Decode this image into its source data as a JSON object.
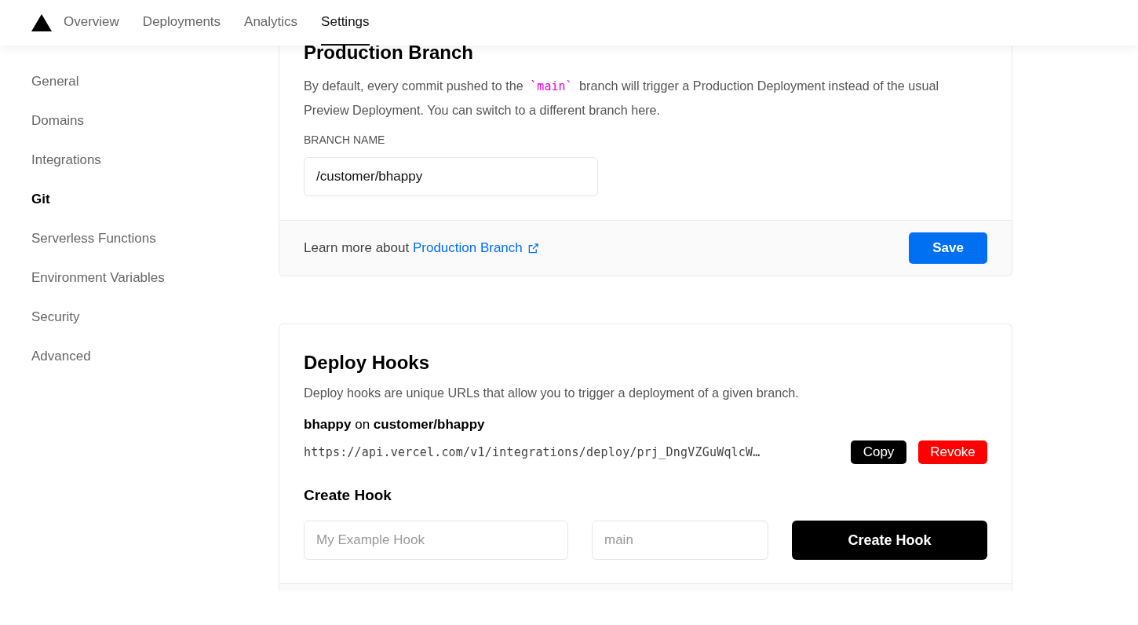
{
  "nav": {
    "tabs": [
      {
        "label": "Overview",
        "selected": false
      },
      {
        "label": "Deployments",
        "selected": false
      },
      {
        "label": "Analytics",
        "selected": false
      },
      {
        "label": "Settings",
        "selected": true
      }
    ]
  },
  "sidebar": {
    "items": [
      {
        "label": "General",
        "selected": false
      },
      {
        "label": "Domains",
        "selected": false
      },
      {
        "label": "Integrations",
        "selected": false
      },
      {
        "label": "Git",
        "selected": true
      },
      {
        "label": "Serverless Functions",
        "selected": false
      },
      {
        "label": "Environment Variables",
        "selected": false
      },
      {
        "label": "Security",
        "selected": false
      },
      {
        "label": "Advanced",
        "selected": false
      }
    ]
  },
  "production_branch": {
    "title": "Production Branch",
    "description": {
      "before": "By default, every commit pushed to the",
      "code": "`main`",
      "after": "branch will trigger a Production Deployment instead of the usual Preview Deployment. You can switch to a different branch here."
    },
    "field_label": "BRANCH NAME",
    "field_value": "/customer/bhappy",
    "footer_text": "Learn more about",
    "footer_link": "Production Branch",
    "save_button": "Save"
  },
  "deploy_hooks": {
    "title": "Deploy Hooks",
    "description": "Deploy hooks are unique URLs that allow you to trigger a deployment of a given branch.",
    "hooks": [
      {
        "title": "**bhappy** on **customer/bhappy**",
        "url": "https://api.vercel.com/v1/integrations/deploy/prj_DngVZGuWqlcW…",
        "copy_button": "Copy",
        "revoke_button": "Revoke"
      }
    ],
    "create_title": "Create Hook",
    "name_placeholder": "My Example Hook",
    "branch_placeholder": "main",
    "create_button": "Create Hook"
  }
}
